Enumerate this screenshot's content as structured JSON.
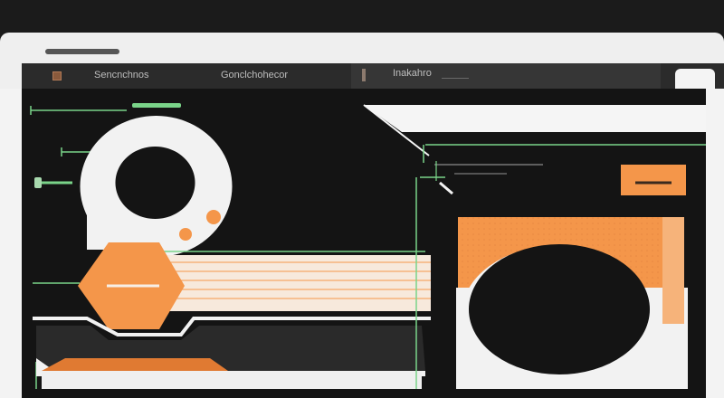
{
  "window": {
    "title_bar_color": "#efefef"
  },
  "tabs": [
    {
      "label": "Sencnchnos",
      "icon": "square-icon"
    },
    {
      "label": "Gonclchohecor",
      "icon": ""
    },
    {
      "label": "Inakahro",
      "icon": "bookmark-icon"
    }
  ],
  "colors": {
    "accent_orange": "#f4964a",
    "accent_green": "#7ad489",
    "background_dark": "#141414",
    "panel_light": "#f3f3f3"
  },
  "icons": {
    "ring": "ring-icon",
    "hexagon": "hexagon-icon",
    "cursor": "cursor-icon",
    "orange_chip": "minus-icon"
  }
}
